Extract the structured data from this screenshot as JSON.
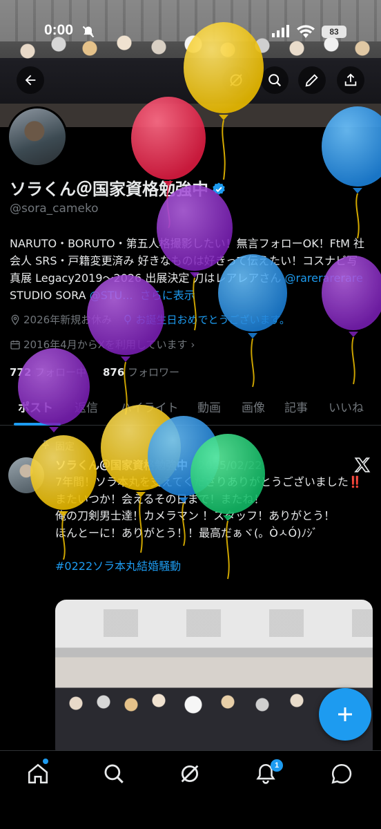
{
  "status": {
    "time": "0:00",
    "battery": "83"
  },
  "profile": {
    "name": "ソラくん＠国家資格勉強中",
    "handle": "@sora_cameko",
    "bio_text": "NARUTO・BORUTO・第五人格撮影したい！無言フォローOK！FtM 社会人 SRS・戸籍変更済み 好きなものは好きって伝えたい！コスナビ写真展 Legacy2019～2026 出展決定 刀はレアレアさん ",
    "bio_link1": "@rarerarerare",
    "bio_mid": " STUDIO SORA ",
    "bio_link2": "@STU...",
    "bio_more": "さらに表示",
    "location": "2026年新規お休み",
    "birthday": "お誕生日おめでとうございます。",
    "joined": "2016年4月からXを利用しています",
    "following_count": "772",
    "following_label": "フォロー中",
    "followers_count": "876",
    "followers_label": "フォロワー"
  },
  "tabs": [
    "ポスト",
    "返信",
    "ハイライト",
    "動画",
    "画像",
    "記事",
    "いいね"
  ],
  "post": {
    "pinned_label": "固定",
    "author": "ソラくん＠国家資格勉強中",
    "date": "· 2025/02/22",
    "line1": "7年間！ソラ本丸を支えてくださりありがとうございました‼️",
    "line2": "またいつか！会えるその日まで！またね！",
    "line3": "俺の刀剣男士達！カメラマン ！スタッフ！ありがとう！",
    "line4": "ほんとーに！ありがとう！！最高だぁヾ(。ÒㅅÓ)ﾉｼﾞ",
    "hashtag": "#0222ソラ本丸結婚騒動"
  },
  "nav": {
    "notification_badge": "1"
  },
  "icons": {
    "back": "back-arrow-icon",
    "grok": "grok-icon",
    "search": "search-icon",
    "edit": "pencil-icon",
    "share": "share-icon",
    "verified": "verified-badge-icon",
    "location": "location-icon",
    "balloon": "balloon-icon",
    "calendar": "calendar-icon",
    "pin": "pin-icon",
    "x": "x-logo-icon",
    "compose": "plus-icon",
    "home": "home-icon",
    "notifications": "bell-icon",
    "messages": "chat-icon"
  },
  "colors": {
    "accent": "#1d9bf0",
    "muted": "#71767b",
    "text": "#e7e9ea"
  }
}
